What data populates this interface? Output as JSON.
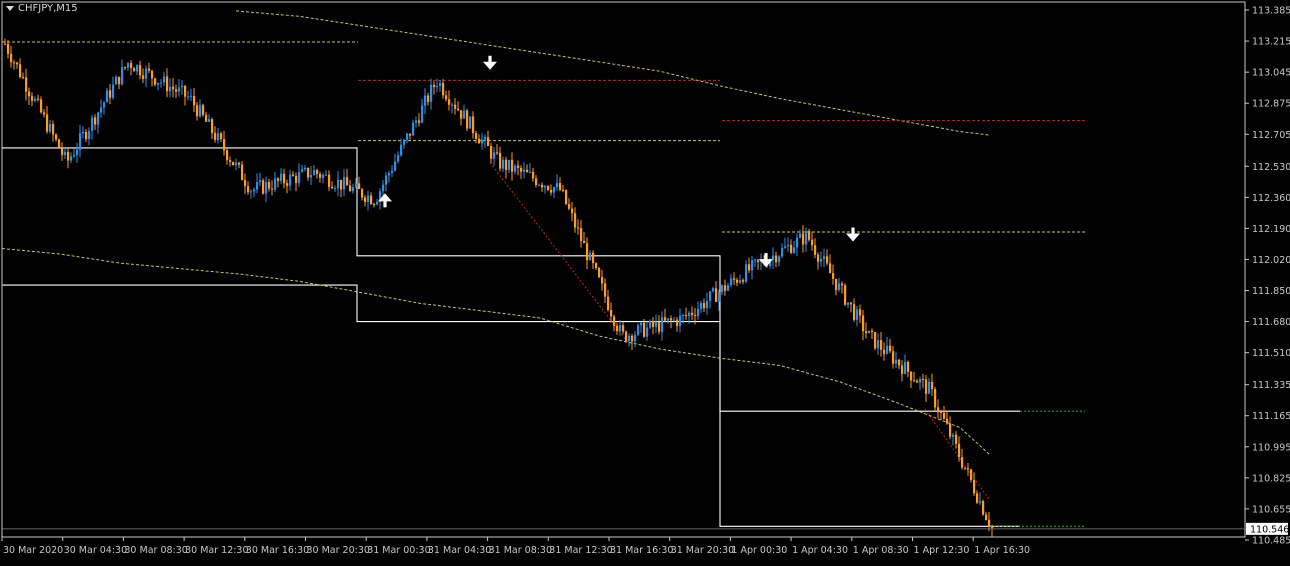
{
  "header": {
    "symbol_label": "CHFJPY,M15",
    "menu_icon": "triangle-down-icon"
  },
  "colors": {
    "background": "#000000",
    "axis": "#c8c8c8",
    "bull_candle": "#2f8fe6",
    "bear_candle": "#ff9c28",
    "support_resistance": "#ffffff",
    "dotted_yellow": "#c8c84a",
    "dotted_red": "#d02020",
    "dotted_green": "#28b828",
    "price_box_bg": "#ffffff",
    "price_box_text": "#000000"
  },
  "price_axis": {
    "labels": [
      "113.385",
      "113.215",
      "113.045",
      "112.875",
      "112.705",
      "112.530",
      "112.360",
      "112.190",
      "112.020",
      "111.850",
      "111.680",
      "111.510",
      "111.335",
      "111.165",
      "110.995",
      "110.825",
      "110.655",
      "110.485"
    ],
    "current_price": "110.546"
  },
  "time_axis": {
    "labels": [
      "30 Mar 2020",
      "30 Mar 04:30",
      "30 Mar 08:30",
      "30 Mar 12:30",
      "30 Mar 16:30",
      "30 Mar 20:30",
      "31 Mar 00:30",
      "31 Mar 04:30",
      "31 Mar 08:30",
      "31 Mar 12:30",
      "31 Mar 16:30",
      "31 Mar 20:30",
      "1 Apr 00:30",
      "1 Apr 04:30",
      "1 Apr 08:30",
      "1 Apr 12:30",
      "1 Apr 16:30"
    ]
  },
  "signals": [
    {
      "type": "sell",
      "icon": "arrow-down-icon",
      "price": 113.08
    },
    {
      "type": "buy",
      "icon": "arrow-up-icon",
      "price": 112.36
    },
    {
      "type": "sell",
      "icon": "arrow-down-icon",
      "price": 112.0
    },
    {
      "type": "sell",
      "icon": "arrow-down-icon",
      "price": 112.14
    }
  ],
  "chart_data": {
    "type": "line",
    "title": "CHFJPY,M15",
    "xlabel": "",
    "ylabel": "",
    "ylim": [
      110.485,
      113.385
    ],
    "x": [
      "30 Mar 2020",
      "30 Mar 04:30",
      "30 Mar 08:30",
      "30 Mar 12:30",
      "30 Mar 16:30",
      "30 Mar 20:30",
      "31 Mar 00:30",
      "31 Mar 04:30",
      "31 Mar 08:30",
      "31 Mar 12:30",
      "31 Mar 16:30",
      "31 Mar 20:30",
      "1 Apr 00:30",
      "1 Apr 04:30",
      "1 Apr 08:30",
      "1 Apr 12:30",
      "1 Apr 16:30"
    ],
    "series": [
      {
        "values": [
          113.2,
          112.55,
          113.1,
          112.9,
          112.4,
          112.5,
          112.35,
          113.0,
          112.55,
          112.4,
          111.6,
          111.7,
          111.95,
          112.15,
          111.6,
          111.3,
          110.55
        ]
      }
    ]
  }
}
